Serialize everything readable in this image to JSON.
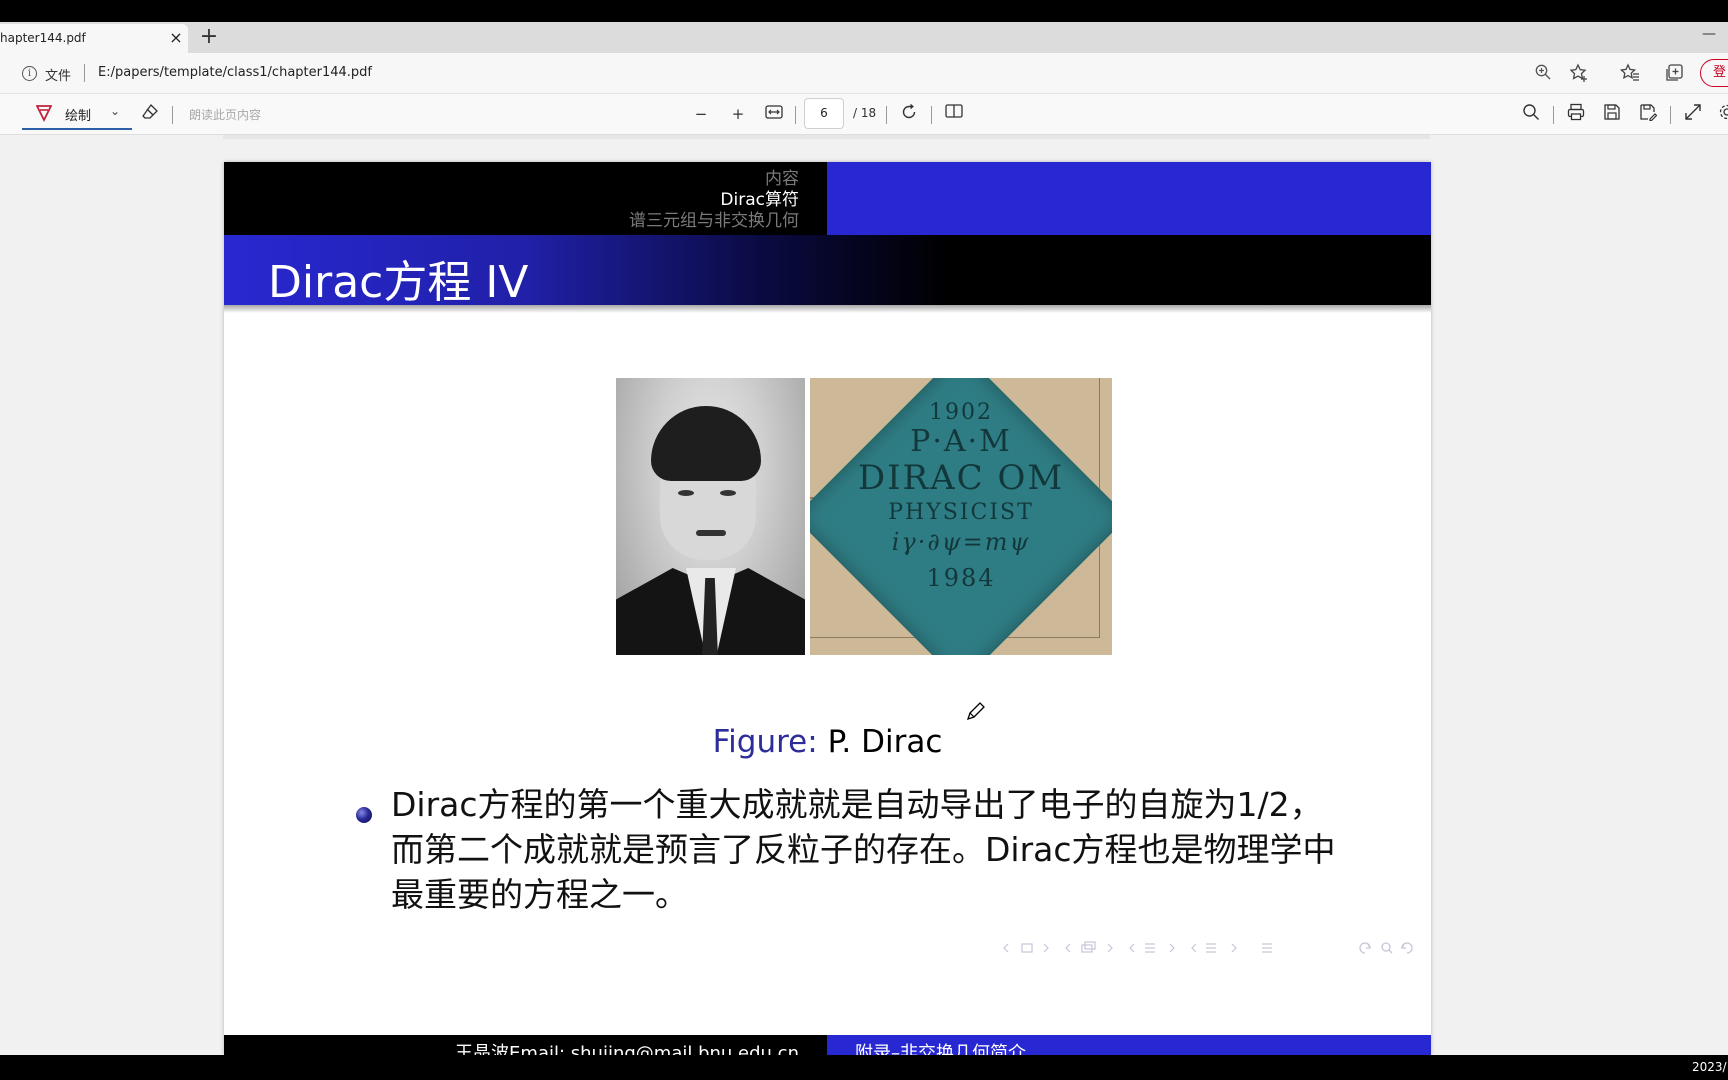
{
  "browser": {
    "tab_title": "hapter144.pdf",
    "tab_close": "×",
    "new_tab": "+",
    "minimize": "—",
    "scheme_label": "文件",
    "url": "E:/papers/template/class1/chapter144.pdf",
    "login_label": "登"
  },
  "pdf_toolbar": {
    "draw_label": "绘制",
    "read_aloud_placeholder": "朗读此页内容",
    "zoom_out": "−",
    "zoom_in": "+",
    "page_current": "6",
    "page_total": "/ 18"
  },
  "slide": {
    "nav_items": [
      "内容",
      "Dirac算符",
      "谱三元组与非交换几何"
    ],
    "title": "Dirac方程 IV",
    "plaque_lines": [
      "1902",
      "P·A·M",
      "DIRAC OM",
      "PHYSICIST",
      "iγ·∂ψ=mψ",
      "1984"
    ],
    "caption_label": "Figure:",
    "caption_text": "P. Dirac",
    "bullet_text": "Dirac方程的第一个重大成就就是自动导出了电子的自旋为1/2，而第二个成就就是预言了反粒子的存在。Dirac方程也是物理学中最重要的方程之一。",
    "footer_left": "王晶波Email: shujing@mail.bnu.edu.cn",
    "footer_right": "附录–非交换几何简介"
  },
  "system": {
    "clock": "2023/"
  },
  "colors": {
    "beamer_blue": "#2828d2",
    "caption_blue": "#2c2c9a",
    "plaque_teal": "#2f7d84"
  }
}
